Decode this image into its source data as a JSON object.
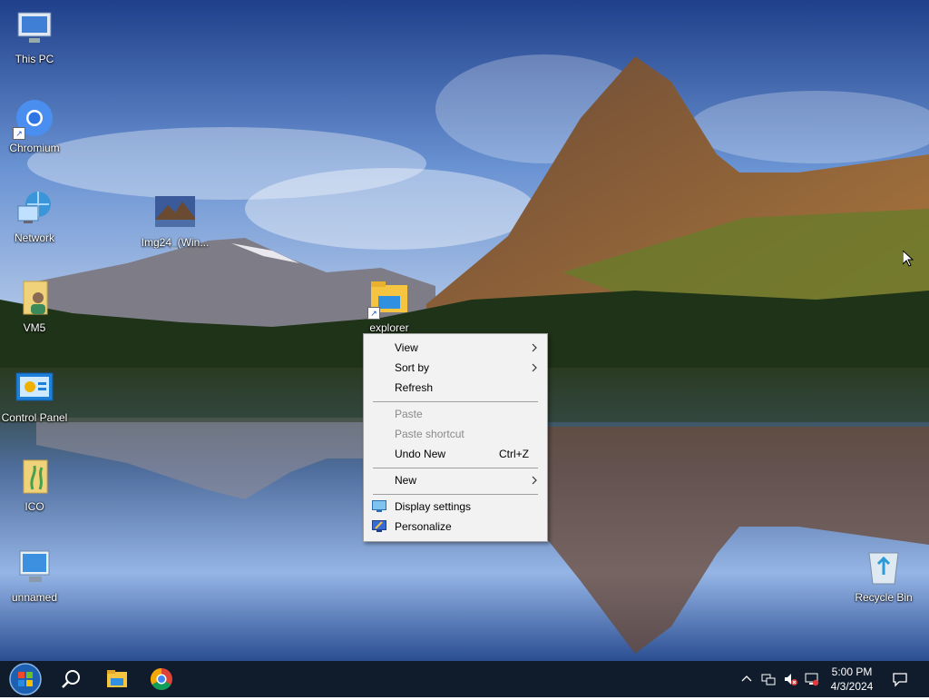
{
  "desktop": {
    "icons": [
      {
        "label": "This PC",
        "icon": "this-pc-icon"
      },
      {
        "label": "Chromium",
        "icon": "chromium-icon"
      },
      {
        "label": "Network",
        "icon": "network-icon"
      },
      {
        "label": "Img24_(Win...",
        "icon": "image-file-icon"
      },
      {
        "label": "VM5",
        "icon": "user-folder-icon"
      },
      {
        "label": "explorer",
        "icon": "explorer-folder-icon"
      },
      {
        "label": "Control Panel",
        "icon": "control-panel-icon"
      },
      {
        "label": "ICO",
        "icon": "ico-folder-icon"
      },
      {
        "label": "unnamed",
        "icon": "monitor-icon"
      },
      {
        "label": "Recycle Bin",
        "icon": "recycle-bin-icon"
      }
    ]
  },
  "context_menu": {
    "items": [
      {
        "label": "View",
        "submenu": true
      },
      {
        "label": "Sort by",
        "submenu": true
      },
      {
        "label": "Refresh"
      },
      {
        "label": "Paste",
        "disabled": true
      },
      {
        "label": "Paste shortcut",
        "disabled": true
      },
      {
        "label": "Undo New",
        "shortcut": "Ctrl+Z"
      },
      {
        "label": "New",
        "submenu": true
      },
      {
        "label": "Display settings",
        "icon": "display-settings-icon"
      },
      {
        "label": "Personalize",
        "icon": "personalize-icon"
      }
    ]
  },
  "taskbar": {
    "pinned": [
      "start-icon",
      "search-icon",
      "file-explorer-icon",
      "chrome-icon"
    ],
    "tray": [
      "chevron-up-icon",
      "network-icon",
      "volume-muted-icon",
      "monitor-icon"
    ],
    "clock": {
      "time": "5:00 PM",
      "date": "4/3/2024"
    },
    "notification_icon": "notification-icon"
  },
  "colors": {
    "taskbar": "#101c2c",
    "menu_bg": "#f2f2f2",
    "accent": "#1a56c4"
  }
}
